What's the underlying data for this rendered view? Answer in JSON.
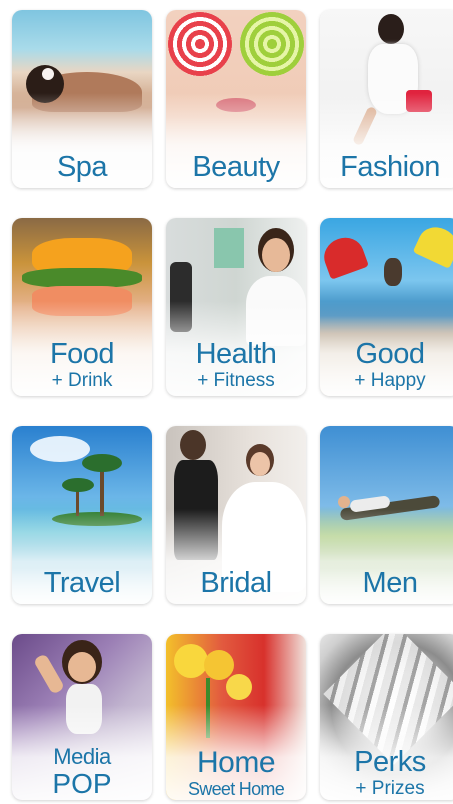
{
  "tiles": [
    {
      "id": "spa",
      "label": "Spa",
      "sub": ""
    },
    {
      "id": "beauty",
      "label": "Beauty",
      "sub": ""
    },
    {
      "id": "fashion",
      "label": "Fashion",
      "sub": ""
    },
    {
      "id": "food",
      "label": "Food",
      "sub": "+ Drink"
    },
    {
      "id": "health",
      "label": "Health",
      "sub": "+ Fitness"
    },
    {
      "id": "good",
      "label": "Good",
      "sub": "+ Happy"
    },
    {
      "id": "travel",
      "label": "Travel",
      "sub": ""
    },
    {
      "id": "bridal",
      "label": "Bridal",
      "sub": ""
    },
    {
      "id": "men",
      "label": "Men",
      "sub": ""
    },
    {
      "id": "media",
      "label": "Media",
      "sub": "POP"
    },
    {
      "id": "home",
      "label": "Home",
      "sub": "Sweet Home"
    },
    {
      "id": "perks",
      "label": "Perks",
      "sub": "+ Prizes"
    }
  ],
  "colors": {
    "label": "#1c75a8"
  }
}
